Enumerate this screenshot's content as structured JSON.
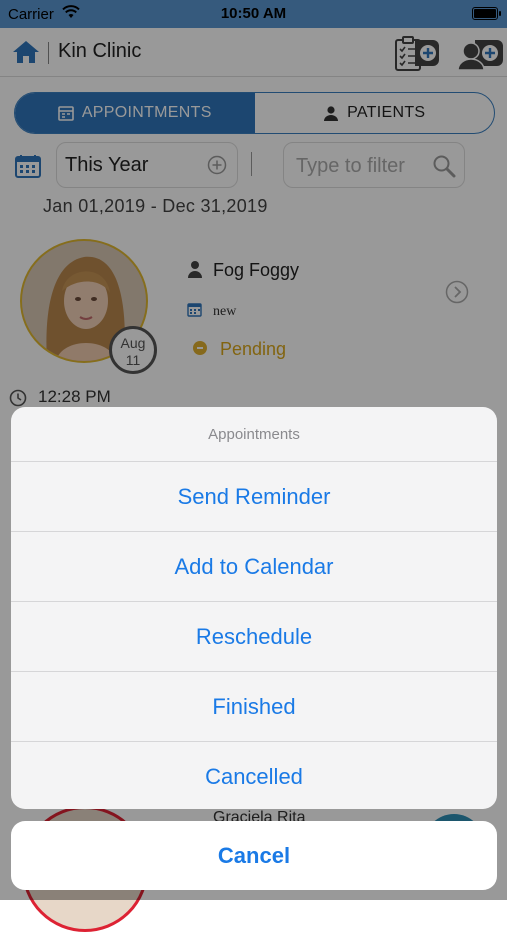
{
  "statusbar": {
    "carrier": "Carrier",
    "time": "10:50 AM"
  },
  "navbar": {
    "title": "Kin Clinic"
  },
  "segments": {
    "appointments": "APPOINTMENTS",
    "patients": "PATIENTS",
    "selected": "appointments"
  },
  "filters": {
    "period": "This Year",
    "search_placeholder": "Type to filter",
    "date_range": "Jan 01,2019 - Dec 31,2019"
  },
  "appointment": {
    "patient_name": "Fog Foggy",
    "type": "new",
    "status": "Pending",
    "month": "Aug",
    "day": "11",
    "time": "12:28 PM"
  },
  "next_appointment": {
    "patient_name": "Graciela Rita"
  },
  "action_sheet": {
    "title": "Appointments",
    "actions": [
      "Send Reminder",
      "Add to Calendar",
      "Reschedule",
      "Finished",
      "Cancelled"
    ],
    "cancel": "Cancel"
  },
  "colors": {
    "accent": "#2f76bb",
    "pending": "#d9a71c",
    "ios_blue": "#1a7ae6"
  }
}
